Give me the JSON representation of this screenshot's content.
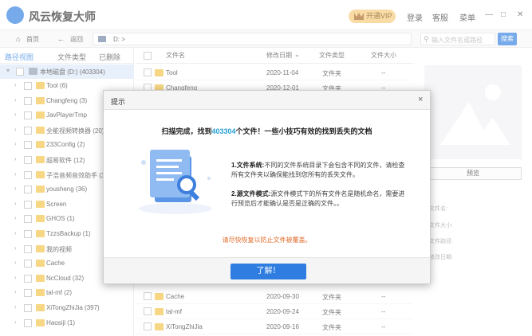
{
  "app": {
    "title": "风云恢复大师",
    "vip_label": "开通VIP",
    "login": "登录",
    "service": "客服",
    "menu": "菜单",
    "minimize": "—",
    "maximize": "□",
    "close": "✕"
  },
  "nav": {
    "home": "首页",
    "back": "返回",
    "path": "D: >",
    "search_placeholder": "输入文件名或路径",
    "search_button": "搜索"
  },
  "sidebar": {
    "tabs": [
      "路径视图",
      "文件类型",
      "已删除"
    ],
    "root": "本地磁盘 (D:) (403304)",
    "items": [
      "Tool (6)",
      "Changfeng (3)",
      "JavPlayerTmp",
      "全能视频转换器 (20)",
      "233Config (2)",
      "超易软件 (12)",
      "子浩音频音效助手 (3",
      "yousheng (36)",
      "Screen",
      "GHOS (1)",
      "TzzsBackup (1)",
      "我的视频",
      "Cache",
      "NcCloud (32)",
      "tal-mf (2)",
      "XiTongZhiJia (397)",
      "Haosiji (1)"
    ]
  },
  "table": {
    "headers": [
      "文件名",
      "修改日期",
      "文件类型",
      "文件大小"
    ],
    "rows": [
      {
        "name": "Tool",
        "date": "2020-11-04",
        "type": "文件夹",
        "size": "--"
      },
      {
        "name": "Changfeng",
        "date": "2020-12-01",
        "type": "文件夹",
        "size": "--"
      },
      {
        "name": "Cache",
        "date": "2020-09-30",
        "type": "文件夹",
        "size": "--"
      },
      {
        "name": "tal-mf",
        "date": "2020-09-24",
        "type": "文件夹",
        "size": "--"
      },
      {
        "name": "XiTongZhiJia",
        "date": "2020-09-16",
        "type": "文件夹",
        "size": "--"
      }
    ]
  },
  "preview": {
    "button": "预览",
    "labels": [
      "文件名:",
      "文件大小:",
      "文件路径:",
      "修改日期:"
    ]
  },
  "dialog": {
    "title": "提示",
    "close": "×",
    "headline_pre": "扫描完成，找到",
    "count": "403304",
    "headline_post": "个文件！一些小技巧有效的找到丢失的文档",
    "tip1_title": "1.文件系统:",
    "tip1_text": "不同的文件系统目录下会包含不同的文件，请检查所有文件夹以确保能找到您所有的丢失文件。",
    "tip2_title": "2.源文件模式:",
    "tip2_text": "源文件模式下的所有文件名是随机命名，需要进行预览后才能确认是否是正确的文件。。",
    "warning": "请尽快恢复以防止文件被覆盖。",
    "ok": "了解！"
  },
  "colors": {
    "accent": "#2f7de1",
    "folder": "#f5c242",
    "warning": "#e06b2b",
    "count": "#2aa0d8"
  }
}
